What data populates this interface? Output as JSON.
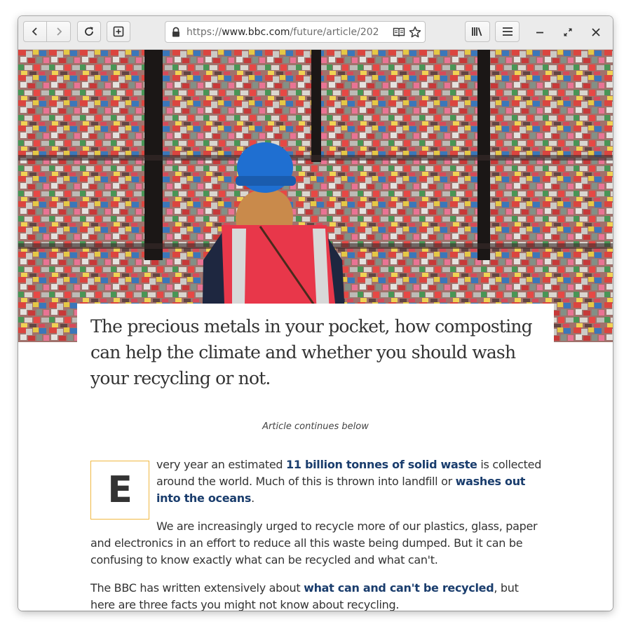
{
  "browser": {
    "url": {
      "scheme": "https://",
      "host": "www.bbc.com",
      "path": "/future/article/202"
    },
    "icons": [
      "back-icon",
      "forward-icon",
      "reload-icon",
      "new-tab-icon",
      "lock-icon",
      "reader-view-icon",
      "star-icon",
      "library-icon",
      "hamburger-menu-icon",
      "minimize-icon",
      "maximize-icon",
      "close-icon"
    ]
  },
  "article": {
    "headline": "The precious metals in your pocket, how composting can help the climate and whether you should wash your recycling or not.",
    "continues_note": "Article continues below",
    "drop_cap": "E",
    "p1": {
      "t1": "very year an estimated ",
      "link1": "11 billion tonnes of solid waste",
      "t2": " is collected around the world. Much of this is thrown into landfill or ",
      "link2": "washes out into the oceans",
      "t3": "."
    },
    "p2": "We are increasingly urged to recycle more of our plastics, glass, paper and electronics in an effort to reduce all this waste being dumped. But it can be confusing to know exactly what can be recycled and what can't.",
    "p3": {
      "t1": "The BBC has written extensively about ",
      "link": "what can and can't be recycled",
      "t2": ", but here are three facts you might not know about recycling."
    }
  },
  "colors": {
    "link": "#1a3d6d",
    "dropcap_border": "#f0b842",
    "hard_hat": "#1f6fd1",
    "vest": "#e8374a"
  }
}
